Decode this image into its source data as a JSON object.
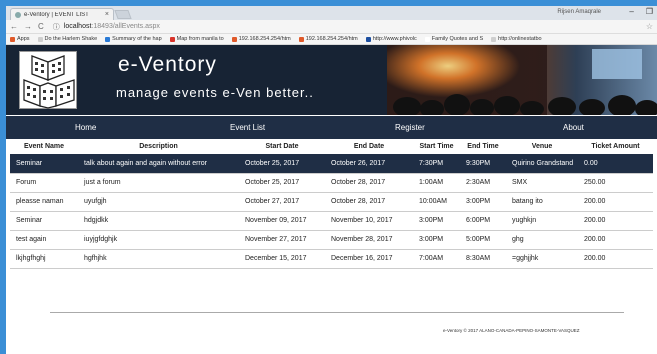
{
  "browser": {
    "tab_title": "e-Ventory | EVENT LIST",
    "tab_close": "×",
    "user_name": "Rijsen Amaqrale",
    "window_controls": [
      "–",
      "❐"
    ],
    "url_host": "localhost",
    "url_path": ":18493/allEvents.aspx",
    "bookmarks": [
      {
        "label": "Apps",
        "color": "#e05a2a"
      },
      {
        "label": "Do the Harlem Shake",
        "color": "#cfcfcf"
      },
      {
        "label": "Summary of the hap",
        "color": "#2a7ad6"
      },
      {
        "label": "Map from manila to",
        "color": "#d9342b"
      },
      {
        "label": "192.168.254.254/htm",
        "color": "#e05a2a"
      },
      {
        "label": "192.168.254.254/htm",
        "color": "#e05a2a"
      },
      {
        "label": "http://www.phivolc",
        "color": "#1d4fa0"
      },
      {
        "label": "Family Quotes and S",
        "color": "#ffffff"
      },
      {
        "label": "http://onlinestatbo",
        "color": "#cfcfcf"
      }
    ]
  },
  "site": {
    "brand": "e-Ventory",
    "tagline": "manage events e-Ven better..",
    "nav": [
      "Home",
      "Event List",
      "Register",
      "About"
    ]
  },
  "table": {
    "headers": [
      "Event Name",
      "Description",
      "Start Date",
      "End Date",
      "Start Time",
      "End Time",
      "Venue",
      "Ticket Amount"
    ],
    "rows": [
      [
        "Seminar",
        "talk about again and again without error",
        "October 25, 2017",
        "October 26, 2017",
        "7:30PM",
        "9:30PM",
        "Quirino Grandstand",
        "0.00"
      ],
      [
        "Forum",
        "just a forum",
        "October 25, 2017",
        "October 28, 2017",
        "1:00AM",
        "2:30AM",
        "SMX",
        "250.00"
      ],
      [
        "pleasse naman",
        "uyufgjh",
        "October 27, 2017",
        "October 28, 2017",
        "10:00AM",
        "3:00PM",
        "batang ito",
        "200.00"
      ],
      [
        "Seminar",
        "hdgjdkk",
        "November 09, 2017",
        "November 10, 2017",
        "3:00PM",
        "6:00PM",
        "yughkjn",
        "200.00"
      ],
      [
        "test again",
        "iuyjgfdghjk",
        "November 27, 2017",
        "November 28, 2017",
        "3:00PM",
        "5:00PM",
        "ghg",
        "200.00"
      ],
      [
        "lkjhgfhghj",
        "hgfhjhk",
        "December 15, 2017",
        "December 16, 2017",
        "7:00AM",
        "8:30AM",
        "=gghjjhk",
        "200.00"
      ]
    ],
    "selected_row": 0
  },
  "footer": "e-Ventory © 2017 ALANO-CANADA-PEPINO-SAMONTE-VASQUEZ",
  "colors": {
    "nav_bg": "#1f2e45",
    "banner_bg": "#172334",
    "desktop": "#3b8fd6"
  }
}
